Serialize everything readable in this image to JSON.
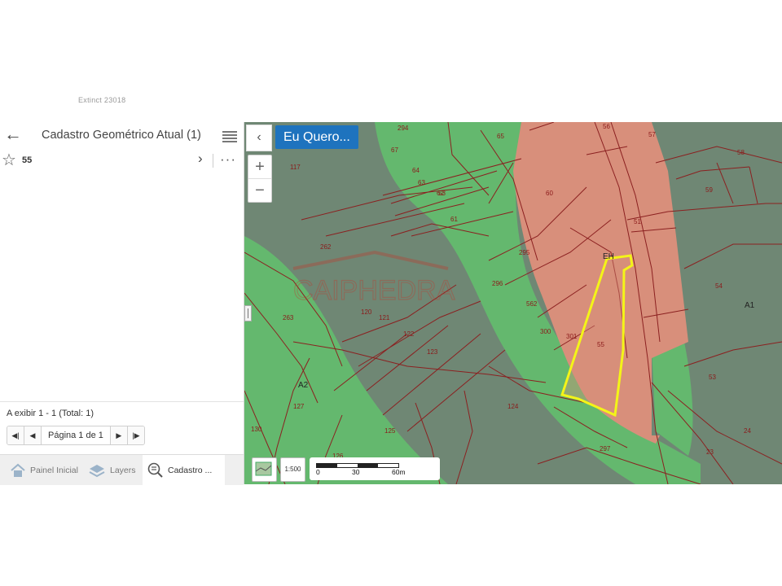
{
  "top_text": "Extinct 23018",
  "panel": {
    "title": "Cadastro Geométrico Atual (1)",
    "feature_id": "55",
    "results": "A exibir 1 - 1 (Total: 1)",
    "pager_label": "Página 1 de 1"
  },
  "tabs": {
    "home": "Painel Inicial",
    "layers": "Layers",
    "cadastro": "Cadastro ..."
  },
  "map": {
    "eu_quero": "Eu Quero...",
    "scale_button": "1:500",
    "scale_ticks": [
      "0",
      "30",
      "60m"
    ],
    "watermark": "CAIPHEDRA",
    "colors": {
      "green": "#64b86e",
      "gray_green": "#6f8774",
      "salmon": "#d88f7b",
      "parcel_line": "#8b2020",
      "highlight": "#f4f418",
      "button_blue": "#1e73be"
    },
    "zones": [
      "A1",
      "A2",
      "EH"
    ],
    "parcels": [
      "55",
      "51",
      "53",
      "54",
      "56",
      "57",
      "58",
      "59",
      "60",
      "61",
      "62",
      "63",
      "64",
      "65",
      "67",
      "117",
      "120",
      "121",
      "122",
      "123",
      "124",
      "125",
      "126",
      "127",
      "130",
      "262",
      "263",
      "294",
      "295",
      "296",
      "297",
      "300",
      "301",
      "562"
    ]
  }
}
